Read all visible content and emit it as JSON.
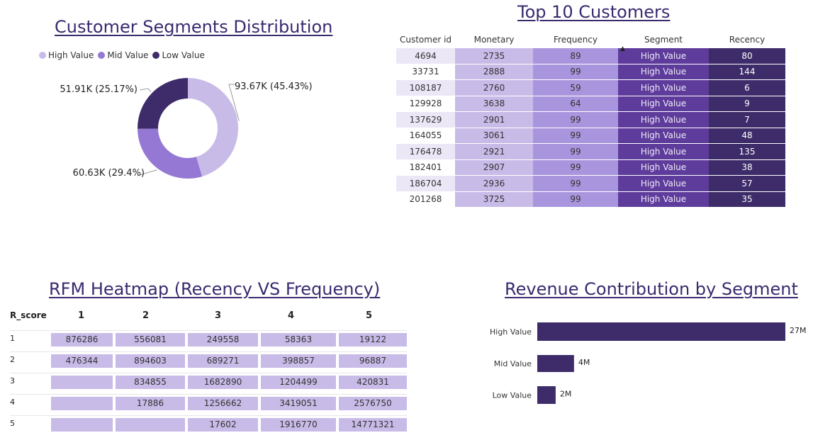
{
  "colors": {
    "title": "#3a2a6e",
    "high_value": "#c8bbe8",
    "mid_value": "#9578d4",
    "low_value": "#3d2c69",
    "bar": "#3d2c69",
    "heat_cell": "#c8bbe8"
  },
  "donut": {
    "title": "Customer Segments Distribution",
    "legend": [
      {
        "name": "High Value",
        "color": "#c8bbe8"
      },
      {
        "name": "Mid Value",
        "color": "#9578d4"
      },
      {
        "name": "Low Value",
        "color": "#3d2c69"
      }
    ]
  },
  "top_customers": {
    "title": "Top 10 Customers",
    "columns": [
      "Customer id",
      "Monetary",
      "Frequency",
      "Segment",
      "Recency"
    ],
    "rows": [
      [
        "4694",
        "2735",
        "89",
        "High Value",
        "80"
      ],
      [
        "33731",
        "2888",
        "99",
        "High Value",
        "144"
      ],
      [
        "108187",
        "2760",
        "59",
        "High Value",
        "6"
      ],
      [
        "129928",
        "3638",
        "64",
        "High Value",
        "9"
      ],
      [
        "137629",
        "2901",
        "99",
        "High Value",
        "7"
      ],
      [
        "164055",
        "3061",
        "99",
        "High Value",
        "48"
      ],
      [
        "176478",
        "2921",
        "99",
        "High Value",
        "135"
      ],
      [
        "182401",
        "2907",
        "99",
        "High Value",
        "38"
      ],
      [
        "186704",
        "2936",
        "99",
        "High Value",
        "57"
      ],
      [
        "201268",
        "3725",
        "99",
        "High Value",
        "35"
      ]
    ]
  },
  "heatmap": {
    "title": "RFM Heatmap (Recency VS Frequency)",
    "corner_label": "R_score",
    "col_headers": [
      "1",
      "2",
      "3",
      "4",
      "5"
    ],
    "row_headers": [
      "1",
      "2",
      "3",
      "4",
      "5"
    ],
    "cells": [
      [
        "876286",
        "556081",
        "249558",
        "58363",
        "19122"
      ],
      [
        "476344",
        "894603",
        "689271",
        "398857",
        "96887"
      ],
      [
        "",
        "834855",
        "1682890",
        "1204499",
        "420831"
      ],
      [
        "",
        "17886",
        "1256662",
        "3419051",
        "2576750"
      ],
      [
        "",
        "",
        "17602",
        "1916770",
        "14771321"
      ]
    ]
  },
  "revenue": {
    "title": "Revenue Contribution by Segment"
  },
  "chart_data": [
    {
      "type": "pie",
      "title": "Customer Segments Distribution",
      "categories": [
        "High Value",
        "Mid Value",
        "Low Value"
      ],
      "values": [
        93670,
        60630,
        51910
      ],
      "percents": [
        45.43,
        29.4,
        25.17
      ],
      "labels": [
        "93.67K (45.43%)",
        "60.63K (29.4%)",
        "51.91K (25.17%)"
      ],
      "colors": [
        "#c8bbe8",
        "#9578d4",
        "#3d2c69"
      ],
      "donut": true,
      "legend": "top-left"
    },
    {
      "type": "bar",
      "orientation": "horizontal",
      "title": "Revenue Contribution by Segment",
      "categories": [
        "High Value",
        "Mid Value",
        "Low Value"
      ],
      "values": [
        27,
        4,
        2
      ],
      "value_labels": [
        "27M",
        "4M",
        "2M"
      ],
      "xlim": [
        0,
        27
      ]
    }
  ]
}
